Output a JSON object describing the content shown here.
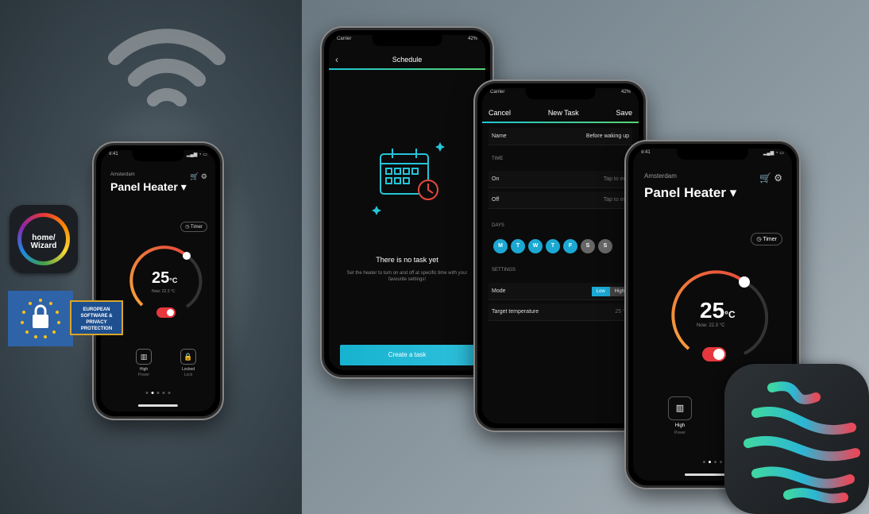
{
  "small_phone": {
    "time": "9:41",
    "city": "Amsterdam",
    "title": "Panel Heater",
    "timer_label": "Timer",
    "temperature": "25",
    "unit": "°C",
    "now": "Now: 22.3 °C",
    "power_label": "High",
    "power_sub": "Power",
    "lock_label": "Locked",
    "lock_sub": "Lock"
  },
  "badges": {
    "homewizard_text": "home/ Wizard",
    "eu_text": "EUROPEAN SOFTWARE & PRIVACY PROTECTION"
  },
  "schedule_phone": {
    "carrier": "Carrier",
    "battery": "42%",
    "title": "Schedule",
    "empty_title": "There is no task yet",
    "empty_hint": "Set the heater to turn on and off at specific time with your favourite settings!",
    "cta": "Create a task"
  },
  "task_phone": {
    "carrier": "Carrier",
    "battery": "42%",
    "cancel": "Cancel",
    "title": "New Task",
    "save": "Save",
    "name_label": "Name",
    "name_value": "Before waking up",
    "time_section": "TIME",
    "on_label": "On",
    "on_value": "Tap to edit",
    "off_label": "Off",
    "off_value": "Tap to edit",
    "days_section": "DAYS",
    "days": [
      "M",
      "T",
      "W",
      "T",
      "F",
      "S",
      "S"
    ],
    "settings_section": "SETTINGS",
    "mode_label": "Mode",
    "mode_low": "Low",
    "mode_high": "High",
    "target_label": "Target temperature",
    "target_value": "25 °C"
  },
  "main_phone": {
    "time": "9:41",
    "city": "Amsterdam",
    "title": "Panel Heater",
    "timer_label": "Timer",
    "temperature": "25",
    "unit": "°C",
    "now": "Now: 22.3 °C",
    "power_label": "High",
    "power_sub": "Power"
  },
  "colors": {
    "accent": "#1ba8d3",
    "toggle_on": "#e6373e",
    "arc_start": "#f7a23b",
    "arc_end": "#e64a3b"
  }
}
